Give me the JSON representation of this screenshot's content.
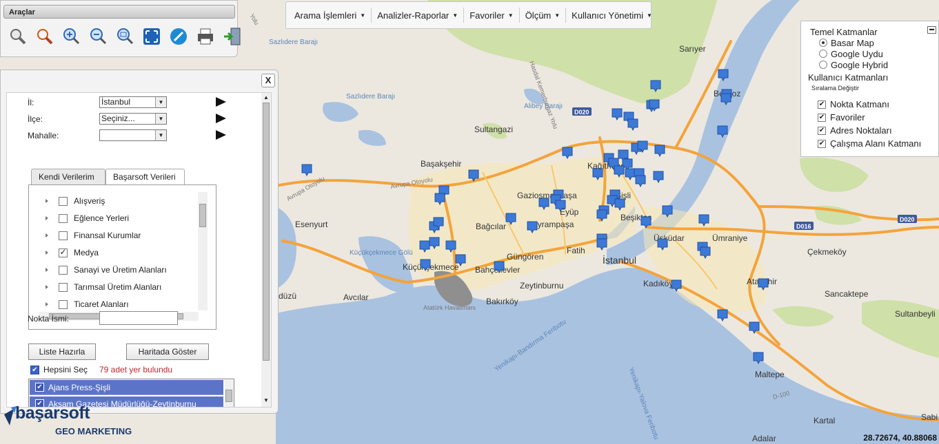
{
  "tools": {
    "title": "Araçlar",
    "icons": [
      "zoom-select-icon",
      "zoom-find-icon",
      "zoom-in-icon",
      "zoom-out-icon",
      "zoom-reset-icon",
      "full-extent-icon",
      "measure-icon",
      "print-icon",
      "exit-icon"
    ]
  },
  "menu": {
    "items": [
      "Arama İşlemleri",
      "Analizler-Raporlar",
      "Favoriler",
      "Ölçüm",
      "Kullanıcı Yönetimi"
    ]
  },
  "layers": {
    "base_title": "Temel Katmanlar",
    "base_layers": [
      {
        "label": "Basar Map",
        "selected": true
      },
      {
        "label": "Google Uydu",
        "selected": false
      },
      {
        "label": "Google Hybrid",
        "selected": false
      }
    ],
    "user_title": "Kullanıcı Katmanları",
    "reorder_label": "Sıralama Değiştir",
    "user_layers": [
      {
        "label": "Nokta Katmanı",
        "checked": true
      },
      {
        "label": "Favoriler",
        "checked": true
      },
      {
        "label": "Adres Noktaları",
        "checked": true
      },
      {
        "label": "Çalışma Alanı Katmanı",
        "checked": true
      }
    ]
  },
  "search": {
    "close_label": "X",
    "il_label": "İl:",
    "il_value": "İstanbul",
    "ilce_label": "İlçe:",
    "ilce_value": "Seçiniz...",
    "mahalle_label": "Mahalle:",
    "mahalle_value": "",
    "tabs": [
      "Kendi Verilerim",
      "Başarsoft Verileri"
    ],
    "categories": [
      {
        "label": "Alışveriş",
        "checked": false
      },
      {
        "label": "Eğlence Yerleri",
        "checked": false
      },
      {
        "label": "Finansal Kurumlar",
        "checked": false
      },
      {
        "label": "Medya",
        "checked": true
      },
      {
        "label": "Sanayi ve Üretim Alanları",
        "checked": false
      },
      {
        "label": "Tarımsal Üretim Alanları",
        "checked": false
      },
      {
        "label": "Ticaret Alanları",
        "checked": false
      }
    ],
    "nokta_label": "Nokta İsmi:",
    "nokta_value": "",
    "btn_list": "Liste Hazırla",
    "btn_map": "Haritada Göster",
    "select_all_label": "Hepsini Seç",
    "found_text": "79 adet yer bulundu",
    "results": [
      "Ajans Press-Şişli",
      "Akşam Gazetesi Müdürlüğü-Zeytinburnu"
    ]
  },
  "logo": {
    "brand": "başarsoft",
    "sub": "GEO MARKETING"
  },
  "coords": "28.72674, 40.88068",
  "map": {
    "places": [
      "Sarıyer",
      "Beykoz",
      "Sultangazi",
      "Başakşehir",
      "Kağıthane",
      "Esenyurt",
      "Gaziosmanpaşa",
      "Eyüp",
      "Şişli",
      "Bağcılar",
      "Bayrampaşa",
      "Beşiktaş",
      "Ümraniye",
      "Üsküdar",
      "Çekmeköy",
      "Küçükçekmece",
      "Güngören",
      "Fatih",
      "Bahçelievler",
      "İstanbul",
      "Zeytinburnu",
      "Kadıköy",
      "Ataşehir",
      "Sancaktepe",
      "Avcılar",
      "Bakırköy",
      "Sultanbeyli",
      "Maltepe",
      "Kartal",
      "Adalar",
      "düzü",
      "Sabi"
    ],
    "water_labels": [
      "Sazlıdere Barajı",
      "Sazlıdere Barajı",
      "Alibey Barajı",
      "Küçükçekmece Gölü",
      "Yenikapı-Bandırma Feribotu",
      "Yenikapı-Yalova Feribotu"
    ],
    "other_labels": [
      "Avrupa Otoyolu",
      "Avrupa Otoyolu",
      "Hasdal Kemerburgaz Yolu",
      "Atatürk Havalimanı",
      "D-100",
      "Yolu"
    ],
    "shields": [
      "D020",
      "D020",
      "D016"
    ]
  }
}
